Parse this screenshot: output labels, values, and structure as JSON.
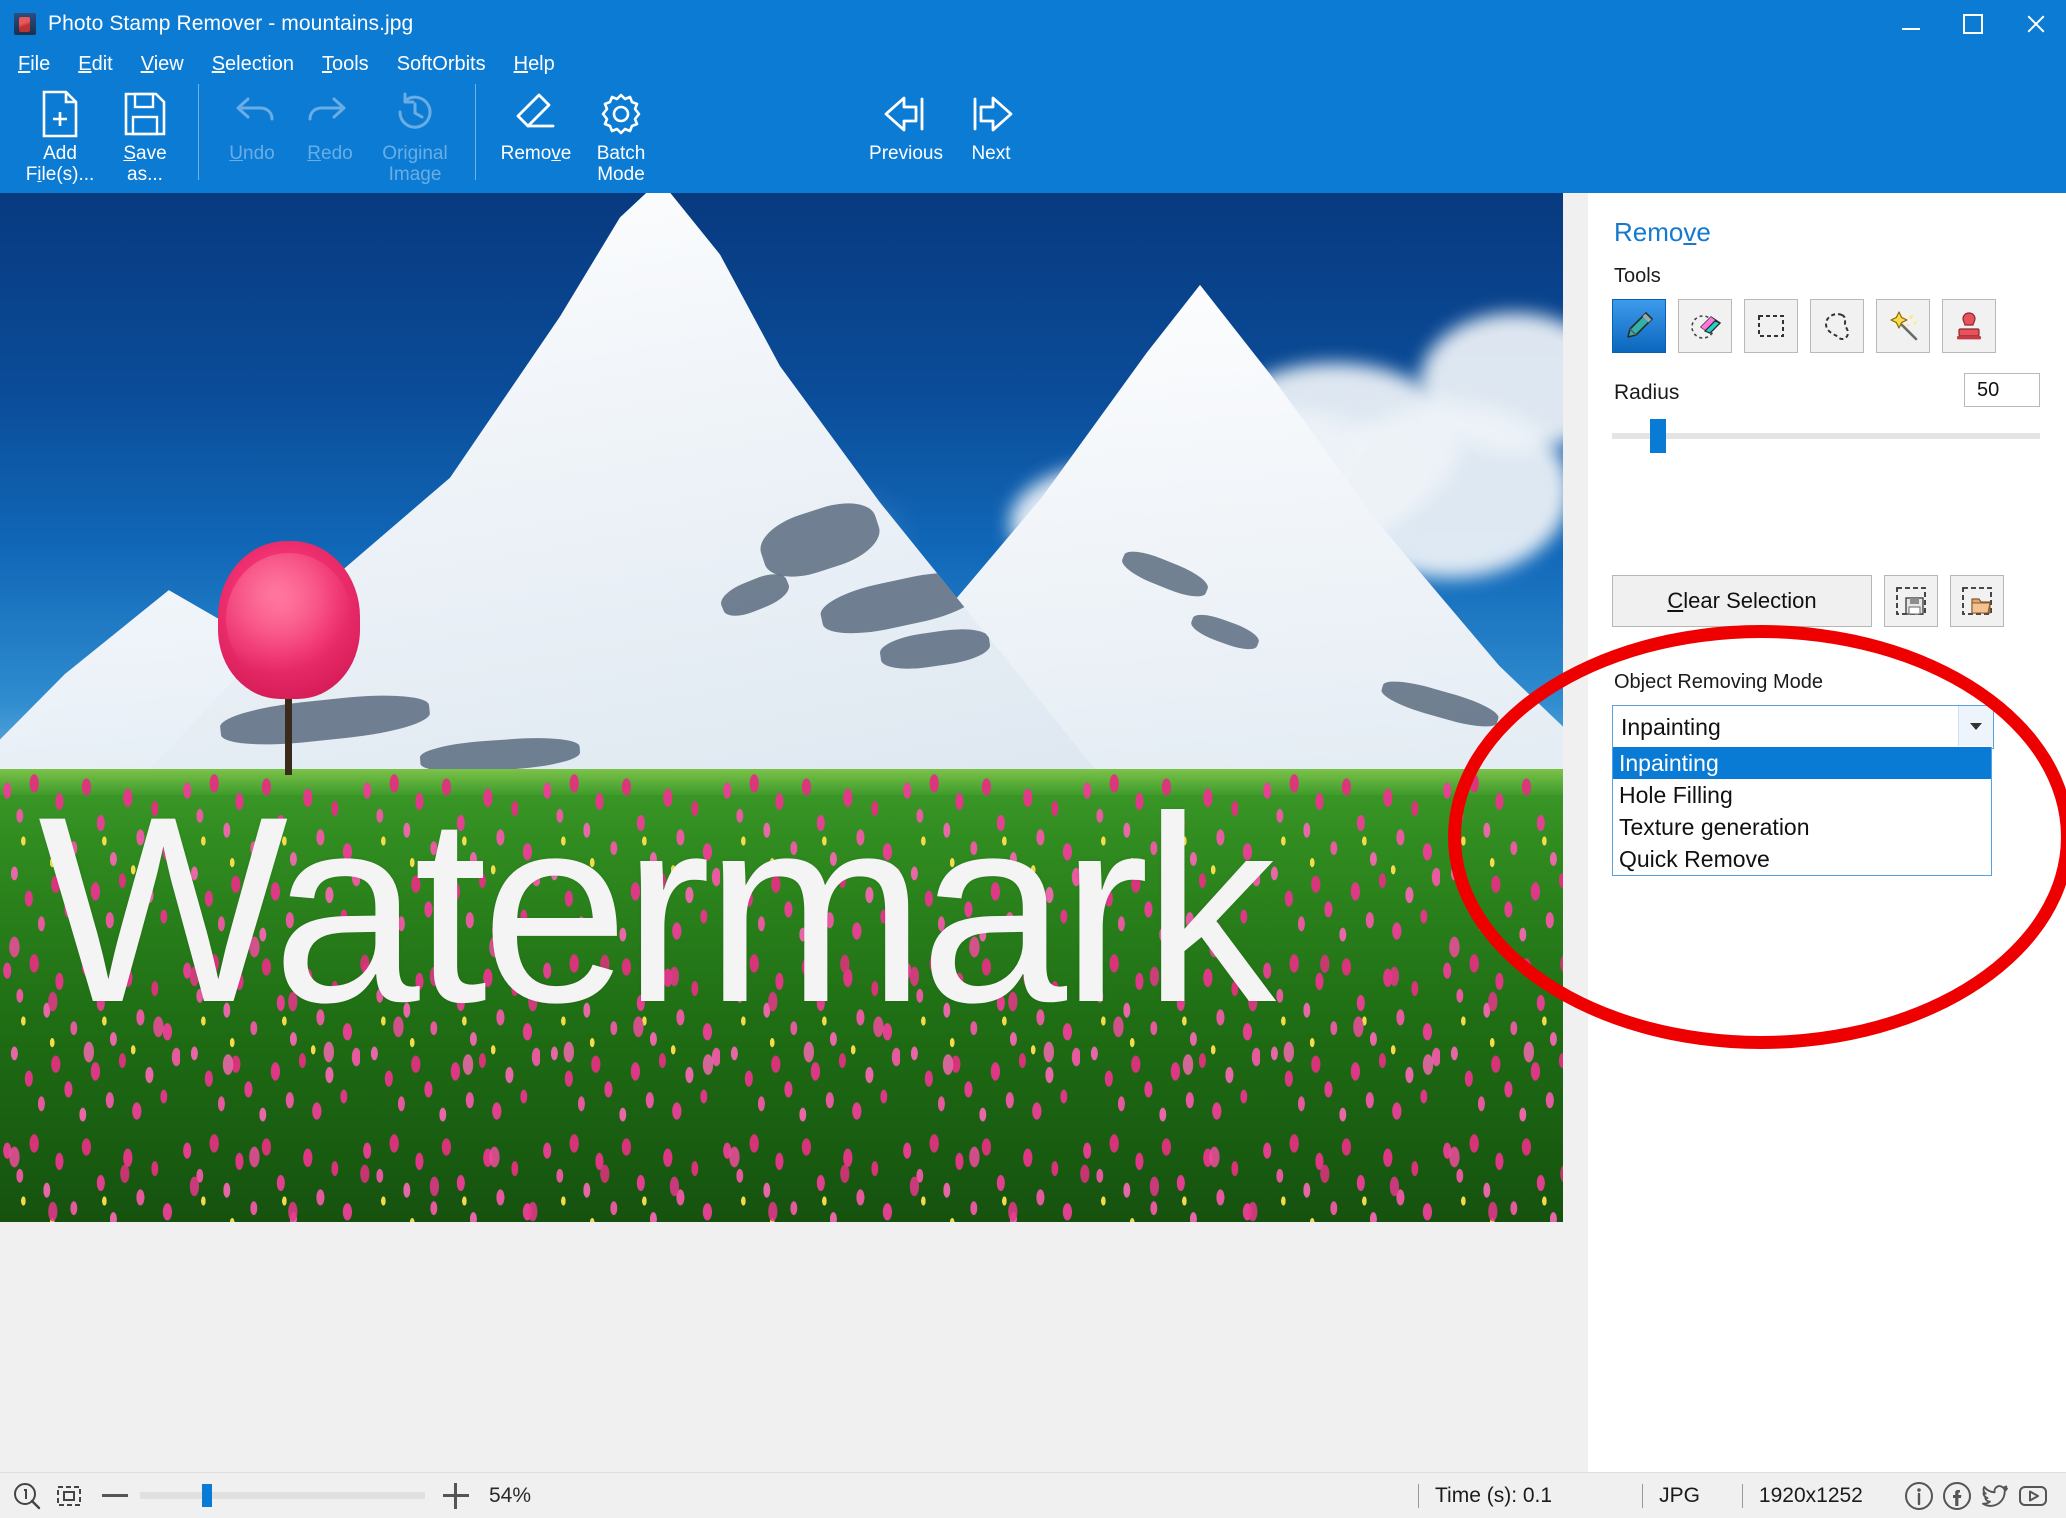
{
  "window": {
    "title": "Photo Stamp Remover - mountains.jpg",
    "icon": "app-icon",
    "controls": {
      "minimize": "minimize",
      "maximize": "maximize",
      "close": "close"
    }
  },
  "menubar": {
    "items": [
      {
        "label": "File",
        "accel": "F"
      },
      {
        "label": "Edit",
        "accel": "E"
      },
      {
        "label": "View",
        "accel": "V"
      },
      {
        "label": "Selection",
        "accel": "S"
      },
      {
        "label": "Tools",
        "accel": "T"
      },
      {
        "label": "SoftOrbits",
        "accel": ""
      },
      {
        "label": "Help",
        "accel": "H"
      }
    ]
  },
  "toolbar": {
    "buttons": [
      {
        "name": "add-files",
        "line1": "Add",
        "line2": "File(s)...",
        "accel": "i",
        "icon": "add-file-icon",
        "enabled": true
      },
      {
        "name": "save-as",
        "line1": "Save",
        "line2": "as...",
        "accel": "S",
        "icon": "save-disk-icon",
        "enabled": true
      },
      {
        "name": "undo",
        "line1": "Undo",
        "line2": "",
        "accel": "U",
        "icon": "undo-arrow-icon",
        "enabled": false
      },
      {
        "name": "redo",
        "line1": "Redo",
        "line2": "",
        "accel": "R",
        "icon": "redo-arrow-icon",
        "enabled": false
      },
      {
        "name": "original-image",
        "line1": "Original",
        "line2": "Image",
        "accel": "",
        "icon": "history-clock-icon",
        "enabled": false
      },
      {
        "name": "remove",
        "line1": "Remove",
        "line2": "",
        "accel": "v",
        "icon": "eraser-icon",
        "enabled": true
      },
      {
        "name": "batch-mode",
        "line1": "Batch",
        "line2": "Mode",
        "accel": "",
        "icon": "gear-icon",
        "enabled": true
      },
      {
        "name": "previous",
        "line1": "Previous",
        "line2": "",
        "accel": "",
        "icon": "arrow-left-icon",
        "enabled": true
      },
      {
        "name": "next",
        "line1": "Next",
        "line2": "",
        "accel": "",
        "icon": "arrow-right-icon",
        "enabled": true
      }
    ]
  },
  "canvas": {
    "watermark_text": "Watermark",
    "image_name": "mountains.jpg",
    "scene": "snow-covered mountains with pink flower meadow and blossoming tree"
  },
  "panel": {
    "title": "Remove",
    "title_accel": "v",
    "tools_label": "Tools",
    "tools": [
      {
        "name": "brush-tool",
        "icon": "brush-icon",
        "selected": true
      },
      {
        "name": "eraser-tool",
        "icon": "eraser-tool-icon",
        "selected": false
      },
      {
        "name": "rectangle-select-tool",
        "icon": "marquee-icon",
        "selected": false
      },
      {
        "name": "lasso-tool",
        "icon": "lasso-icon",
        "selected": false
      },
      {
        "name": "magic-wand-tool",
        "icon": "magic-wand-icon",
        "selected": false
      },
      {
        "name": "stamp-tool",
        "icon": "stamp-icon",
        "selected": false
      }
    ],
    "radius_label": "Radius",
    "radius_value": "50",
    "radius_percent": 9,
    "clear_selection_label": "Clear Selection",
    "clear_selection_accel": "C",
    "save_selection_icon": "save-selection-icon",
    "load_selection_icon": "open-selection-icon",
    "removing_mode_label": "Object Removing Mode",
    "removing_mode_value": "Inpainting",
    "removing_mode_options": [
      {
        "label": "Inpainting",
        "highlighted": true
      },
      {
        "label": "Hole Filling",
        "highlighted": false
      },
      {
        "label": "Texture generation",
        "highlighted": false
      },
      {
        "label": "Quick Remove",
        "highlighted": false
      }
    ],
    "annotation": "red-ellipse-highlight"
  },
  "statusbar": {
    "fit_icon": "zoom-actual-size-icon",
    "fit_window_icon": "fit-to-window-icon",
    "zoom_out_icon": "zoom-out-icon",
    "zoom_in_icon": "zoom-in-icon",
    "zoom_percent": "54%",
    "zoom_slider_percent": 22,
    "time_text": "Time (s): 0.1",
    "format_text": "JPG",
    "dimensions_text": "1920x1252",
    "social": [
      {
        "name": "info-icon",
        "glyph": "i"
      },
      {
        "name": "facebook-icon",
        "glyph": "f"
      },
      {
        "name": "twitter-icon",
        "glyph": "t"
      },
      {
        "name": "youtube-icon",
        "glyph": "y"
      }
    ]
  },
  "colors": {
    "titlebar": "#0c7bd4",
    "accent": "#0a7bd4",
    "annotation_red": "#ee0000",
    "panel_bg": "#ffffff",
    "statusbar_bg": "#f0f0f0"
  }
}
